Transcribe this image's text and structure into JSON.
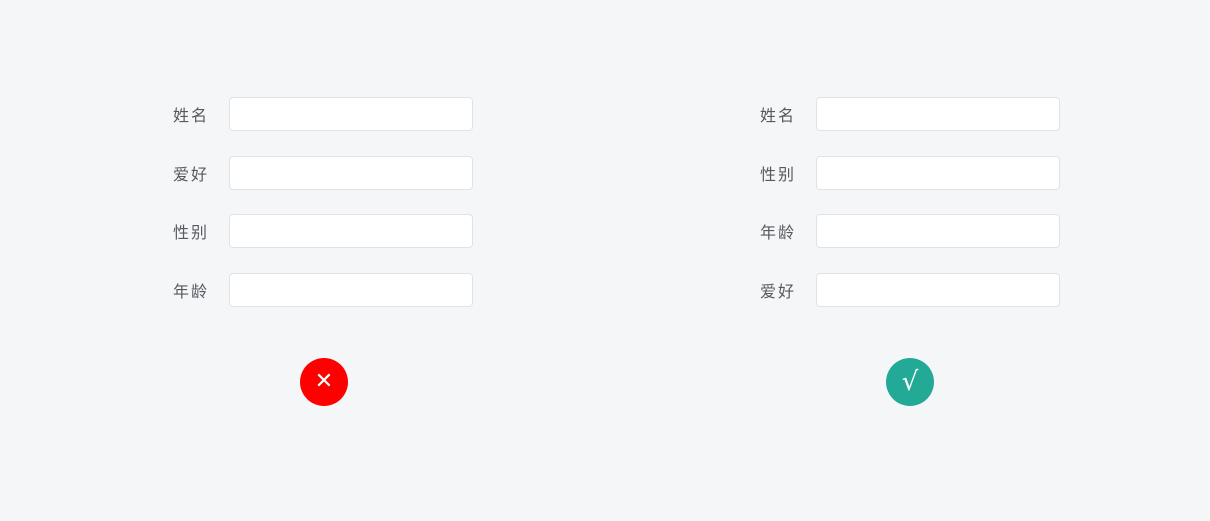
{
  "left_form": {
    "fields": [
      {
        "label": "姓名",
        "value": ""
      },
      {
        "label": "爱好",
        "value": ""
      },
      {
        "label": "性别",
        "value": ""
      },
      {
        "label": "年龄",
        "value": ""
      }
    ],
    "status": {
      "glyph": "✕",
      "icon": "close-icon",
      "color": "#ff0000"
    }
  },
  "right_form": {
    "fields": [
      {
        "label": "姓名",
        "value": ""
      },
      {
        "label": "性别",
        "value": ""
      },
      {
        "label": "年龄",
        "value": ""
      },
      {
        "label": "爱好",
        "value": ""
      }
    ],
    "status": {
      "glyph": "√",
      "icon": "check-icon",
      "color": "#22aa96"
    }
  }
}
